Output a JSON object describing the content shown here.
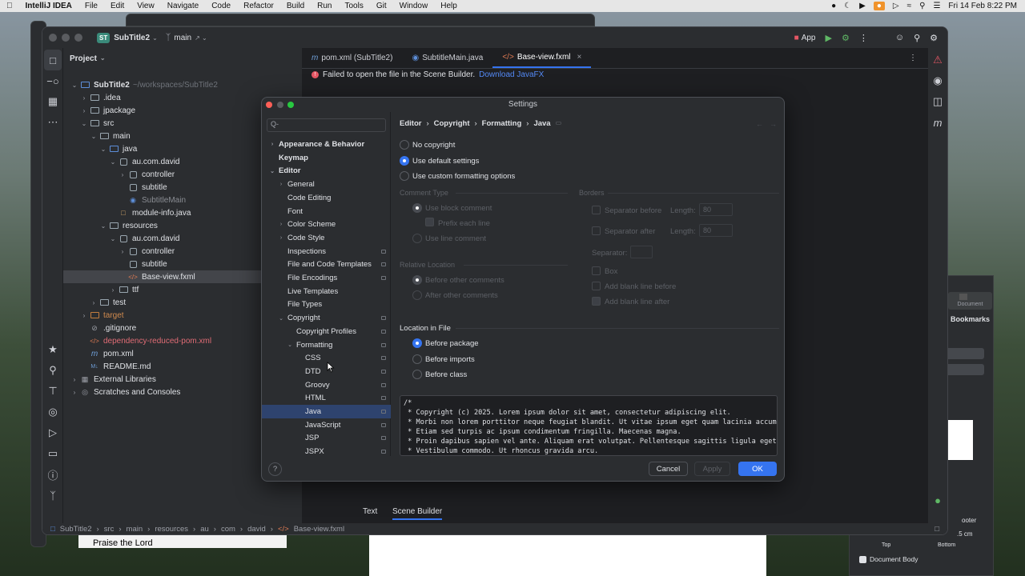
{
  "menubar": {
    "app_name": "IntelliJ IDEA",
    "items": [
      "File",
      "Edit",
      "View",
      "Navigate",
      "Code",
      "Refactor",
      "Build",
      "Run",
      "Tools",
      "Git",
      "Window",
      "Help"
    ],
    "datetime": "Fri 14 Feb 8:22 PM"
  },
  "ide": {
    "project_badge": "ST",
    "project_name": "SubTitle2",
    "branch": "main",
    "run_config": "App",
    "project_panel_title": "Project",
    "tree": [
      {
        "label": "SubTitle2",
        "suffix": "~/workspaces/SubTitle2",
        "depth": 0,
        "expanded": true,
        "kind": "module"
      },
      {
        "label": ".idea",
        "depth": 1,
        "expanded": false,
        "kind": "folder"
      },
      {
        "label": "jpackage",
        "depth": 1,
        "expanded": false,
        "kind": "folder"
      },
      {
        "label": "src",
        "depth": 1,
        "expanded": true,
        "kind": "folder"
      },
      {
        "label": "main",
        "depth": 2,
        "expanded": true,
        "kind": "folder"
      },
      {
        "label": "java",
        "depth": 3,
        "expanded": true,
        "kind": "srcfolder"
      },
      {
        "label": "au.com.david",
        "depth": 4,
        "expanded": true,
        "kind": "package"
      },
      {
        "label": "controller",
        "depth": 5,
        "expanded": false,
        "kind": "package"
      },
      {
        "label": "subtitle",
        "depth": 5,
        "expanded": null,
        "kind": "package"
      },
      {
        "label": "SubtitleMain",
        "depth": 5,
        "expanded": null,
        "kind": "class"
      },
      {
        "label": "module-info.java",
        "depth": 4,
        "expanded": null,
        "kind": "java"
      },
      {
        "label": "resources",
        "depth": 3,
        "expanded": true,
        "kind": "resfolder"
      },
      {
        "label": "au.com.david",
        "depth": 4,
        "expanded": true,
        "kind": "package"
      },
      {
        "label": "controller",
        "depth": 5,
        "expanded": false,
        "kind": "package"
      },
      {
        "label": "subtitle",
        "depth": 5,
        "expanded": null,
        "kind": "package"
      },
      {
        "label": "Base-view.fxml",
        "depth": 5,
        "expanded": null,
        "kind": "fxml",
        "selected": true
      },
      {
        "label": "ttf",
        "depth": 4,
        "expanded": false,
        "kind": "folder"
      },
      {
        "label": "test",
        "depth": 2,
        "expanded": false,
        "kind": "folder"
      },
      {
        "label": "target",
        "depth": 1,
        "expanded": false,
        "kind": "excluded"
      },
      {
        "label": ".gitignore",
        "depth": 1,
        "expanded": null,
        "kind": "ignore"
      },
      {
        "label": "dependency-reduced-pom.xml",
        "depth": 1,
        "expanded": null,
        "kind": "xmlred"
      },
      {
        "label": "pom.xml",
        "depth": 1,
        "expanded": null,
        "kind": "maven"
      },
      {
        "label": "README.md",
        "depth": 1,
        "expanded": null,
        "kind": "md"
      },
      {
        "label": "External Libraries",
        "depth": 0,
        "expanded": false,
        "kind": "lib"
      },
      {
        "label": "Scratches and Consoles",
        "depth": 0,
        "expanded": false,
        "kind": "scratch"
      }
    ],
    "tabs": [
      {
        "label": "pom.xml (SubTitle2)",
        "icon": "m",
        "active": false
      },
      {
        "label": "SubtitleMain.java",
        "icon": "class",
        "active": false
      },
      {
        "label": "Base-view.fxml",
        "icon": "fxml",
        "active": true
      }
    ],
    "notice": "Failed to open the file in the Scene Builder.",
    "notice_link": "Download JavaFX",
    "bottom_tabs": [
      "Text",
      "Scene Builder"
    ],
    "breadcrumbs": [
      "SubTitle2",
      "src",
      "main",
      "resources",
      "au",
      "com",
      "david",
      "Base-view.fxml"
    ]
  },
  "settings": {
    "title": "Settings",
    "search_placeholder": "Q-",
    "nav": [
      {
        "label": "Appearance & Behavior",
        "depth": 0,
        "arrow": "right",
        "bold": true
      },
      {
        "label": "Keymap",
        "depth": 0,
        "arrow": "",
        "bold": true
      },
      {
        "label": "Editor",
        "depth": 0,
        "arrow": "down",
        "bold": true
      },
      {
        "label": "General",
        "depth": 1,
        "arrow": "right"
      },
      {
        "label": "Code Editing",
        "depth": 1,
        "arrow": ""
      },
      {
        "label": "Font",
        "depth": 1,
        "arrow": ""
      },
      {
        "label": "Color Scheme",
        "depth": 1,
        "arrow": "right"
      },
      {
        "label": "Code Style",
        "depth": 1,
        "arrow": "right"
      },
      {
        "label": "Inspections",
        "depth": 1,
        "arrow": "",
        "pin": true
      },
      {
        "label": "File and Code Templates",
        "depth": 1,
        "arrow": "",
        "pin": true
      },
      {
        "label": "File Encodings",
        "depth": 1,
        "arrow": "",
        "pin": true
      },
      {
        "label": "Live Templates",
        "depth": 1,
        "arrow": ""
      },
      {
        "label": "File Types",
        "depth": 1,
        "arrow": ""
      },
      {
        "label": "Copyright",
        "depth": 1,
        "arrow": "down",
        "pin": true
      },
      {
        "label": "Copyright Profiles",
        "depth": 2,
        "arrow": "",
        "pin": true
      },
      {
        "label": "Formatting",
        "depth": 2,
        "arrow": "down",
        "pin": true
      },
      {
        "label": "CSS",
        "depth": 3,
        "arrow": "",
        "pin": true
      },
      {
        "label": "DTD",
        "depth": 3,
        "arrow": "",
        "pin": true
      },
      {
        "label": "Groovy",
        "depth": 3,
        "arrow": "",
        "pin": true
      },
      {
        "label": "HTML",
        "depth": 3,
        "arrow": "",
        "pin": true
      },
      {
        "label": "Java",
        "depth": 3,
        "arrow": "",
        "pin": true,
        "selected": true
      },
      {
        "label": "JavaScript",
        "depth": 3,
        "arrow": "",
        "pin": true
      },
      {
        "label": "JSP",
        "depth": 3,
        "arrow": "",
        "pin": true
      },
      {
        "label": "JSPX",
        "depth": 3,
        "arrow": "",
        "pin": true
      }
    ],
    "breadcrumb": [
      "Editor",
      "Copyright",
      "Formatting",
      "Java"
    ],
    "mode_options": [
      {
        "label": "No copyright",
        "checked": false
      },
      {
        "label": "Use default settings",
        "checked": true
      },
      {
        "label": "Use custom formatting options",
        "checked": false
      }
    ],
    "comment_type": {
      "title": "Comment Type",
      "block": "Use block comment",
      "prefix": "Prefix each line",
      "line": "Use line comment"
    },
    "relative_location": {
      "title": "Relative Location",
      "before": "Before other comments",
      "after": "After other comments"
    },
    "borders": {
      "title": "Borders",
      "sep_before": "Separator before",
      "sep_after": "Separator after",
      "length_label": "Length:",
      "length_before": "80",
      "length_after": "80",
      "separator_label": "Separator:",
      "box": "Box",
      "blank_before": "Add blank line before",
      "blank_after": "Add blank line after"
    },
    "location_in_file": {
      "title": "Location in File",
      "options": [
        {
          "label": "Before package",
          "checked": true
        },
        {
          "label": "Before imports",
          "checked": false
        },
        {
          "label": "Before class",
          "checked": false
        }
      ]
    },
    "preview_text": "/*\n * Copyright (c) 2025. Lorem ipsum dolor sit amet, consectetur adipiscing elit.\n * Morbi non lorem porttitor neque feugiat blandit. Ut vitae ipsum eget quam lacinia accumsan.\n * Etiam sed turpis ac ipsum condimentum fringilla. Maecenas magna.\n * Proin dapibus sapien vel ante. Aliquam erat volutpat. Pellentesque sagittis ligula eget metus.\n * Vestibulum commodo. Ut rhoncus gravida arcu.",
    "buttons": {
      "help": "?",
      "cancel": "Cancel",
      "apply": "Apply",
      "ok": "OK"
    }
  },
  "background": {
    "bookmarks_label": "Bookmarks",
    "document_label": "Document",
    "footer_label": "ooter",
    "measure": ".5 cm",
    "top_label": "Top",
    "bottom_label": "Bottom",
    "document_body": "Document Body",
    "left_doc_text": "Praise the Lord"
  },
  "colors": {
    "accent": "#3574f0",
    "selection": "#2e436e",
    "error": "#e55765",
    "link": "#548af7"
  }
}
